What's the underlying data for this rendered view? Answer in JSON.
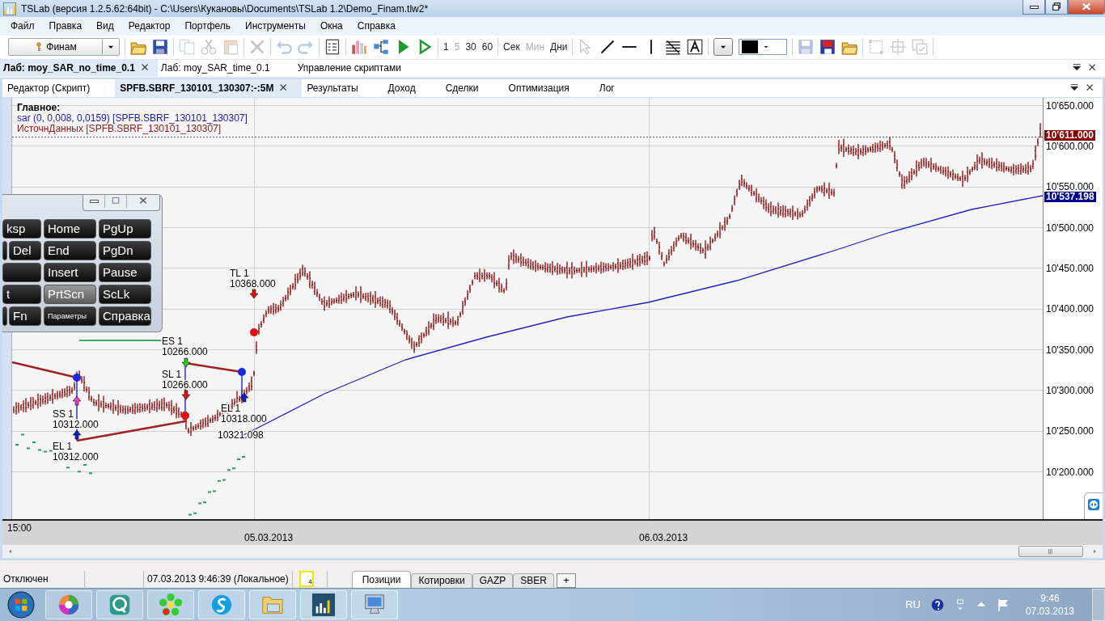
{
  "window": {
    "title": "TSLab (версия 1.2.5.62:64bit) - C:\\Users\\Кукановы\\Documents\\TSLab 1.2\\Demo_Finam.tlw2*"
  },
  "menu": [
    "Файл",
    "Правка",
    "Вид",
    "Редактор",
    "Портфель",
    "Инструменты",
    "Окна",
    "Справка"
  ],
  "toolbar": [
    [
      {
        "kind": "combo",
        "label": "Финам"
      }
    ],
    [
      {
        "kind": "open",
        "disabled": false
      },
      {
        "kind": "save",
        "disabled": false
      }
    ],
    [
      {
        "kind": "copy",
        "disabled": true
      },
      {
        "kind": "cut",
        "disabled": true
      },
      {
        "kind": "paste",
        "disabled": true
      }
    ],
    [
      {
        "kind": "delete",
        "disabled": true
      }
    ],
    [
      {
        "kind": "undo",
        "disabled": true
      },
      {
        "kind": "redo",
        "disabled": true
      }
    ],
    [
      {
        "kind": "properties",
        "disabled": false
      }
    ],
    [
      {
        "kind": "bars",
        "disabled": false
      },
      {
        "kind": "tree",
        "disabled": false
      },
      {
        "kind": "play",
        "disabled": false
      },
      {
        "kind": "play-outline",
        "disabled": false
      }
    ],
    [
      {
        "kind": "text",
        "label": "1",
        "disabled": false
      },
      {
        "kind": "text",
        "label": "5",
        "disabled": true
      },
      {
        "kind": "text",
        "label": "30",
        "disabled": false
      },
      {
        "kind": "text",
        "label": "60",
        "disabled": false
      }
    ],
    [
      {
        "kind": "text",
        "label": "Сек",
        "disabled": false
      },
      {
        "kind": "text",
        "label": "Мин",
        "disabled": true
      },
      {
        "kind": "text",
        "label": "Дни",
        "disabled": false
      }
    ],
    [
      {
        "kind": "cursor",
        "disabled": true
      },
      {
        "kind": "line",
        "disabled": false
      },
      {
        "kind": "hline",
        "disabled": false
      },
      {
        "kind": "vline",
        "disabled": false
      },
      {
        "kind": "hatch",
        "disabled": false
      },
      {
        "kind": "textbox",
        "disabled": false
      }
    ],
    [
      {
        "kind": "dropdown"
      },
      {
        "kind": "swatch"
      }
    ],
    [
      {
        "kind": "save",
        "disabled": true
      },
      {
        "kind": "saveas",
        "disabled": false
      },
      {
        "kind": "open",
        "disabled": false
      }
    ],
    [
      {
        "kind": "frame",
        "disabled": true
      },
      {
        "kind": "frame2",
        "disabled": true
      },
      {
        "kind": "pages",
        "disabled": true
      }
    ]
  ],
  "doc_tabs": [
    {
      "label": "Лаб: moy_SAR_no_time_0.1",
      "selected": true
    },
    {
      "label": "Лаб: moy_SAR_time_0.1",
      "selected": false
    },
    {
      "label": "Управление скриптами",
      "selected": false
    }
  ],
  "inner_tabs": [
    {
      "label": "Редактор (Скрипт)",
      "selected": false
    },
    {
      "label": "SPFB.SBRF_130101_130307:-:5M",
      "selected": true
    },
    {
      "label": "Результаты",
      "selected": false
    },
    {
      "label": "Доход",
      "selected": false
    },
    {
      "label": "Сделки",
      "selected": false
    },
    {
      "label": "Оптимизация",
      "selected": false
    },
    {
      "label": "Лог",
      "selected": false
    }
  ],
  "chart": {
    "legend_title": "Главное:",
    "legend": [
      {
        "text": "sar (0, 0,008, 0,0159) [SPFB.SBRF_130101_130307]",
        "color": "#1a1aa0"
      },
      {
        "text": "ИсточнДанных [SPFB.SBRF_130101_130307]",
        "color": "#8b1a1a"
      }
    ],
    "y_axis_labels": [
      "10'650.000",
      "10'600.000",
      "10'550.000",
      "10'500.000",
      "10'450.000",
      "10'400.000",
      "10'350.000",
      "10'300.000",
      "10'250.000",
      "10'200.000"
    ],
    "price_labels": [
      {
        "text": "10'611.000",
        "color": "#8b0000"
      },
      {
        "text": "10'537.198",
        "color": "#00008b"
      }
    ],
    "trade_labels": [
      {
        "signal": "TL 1",
        "price": "10368.000"
      },
      {
        "signal": "ES 1",
        "price": "10266.000"
      },
      {
        "signal": "SL 1",
        "price": "10266.000"
      },
      {
        "signal": "SS 1",
        "price": "10312.000"
      },
      {
        "signal": "EL 1",
        "price": "10312.000"
      },
      {
        "signal": "EL 1",
        "price": "10318.000"
      },
      {
        "price": "10321.098"
      }
    ],
    "time_labels": [
      "15:00",
      "05.03.2013",
      "06.03.2013"
    ]
  },
  "keyboard": [
    {
      "label": "ksp",
      "active": false
    },
    {
      "label": "Home",
      "active": false
    },
    {
      "label": "PgUp",
      "active": false
    },
    {
      "active": false
    },
    {
      "label": "Del",
      "active": false
    },
    {
      "label": "End",
      "active": false
    },
    {
      "label": "PgDn",
      "active": false
    },
    {
      "active": false
    },
    {
      "label": "Insert",
      "active": false
    },
    {
      "label": "Pause",
      "active": false
    },
    {
      "label": "t",
      "active": false
    },
    {
      "label": "PrtScn",
      "active": true
    },
    {
      "label": "ScLk",
      "active": false
    },
    {
      "active": false
    },
    {
      "label": "Fn",
      "active": false
    },
    {
      "label": "Параметры",
      "active": false
    },
    {
      "label": "Справка",
      "active": false
    }
  ],
  "status_bar": {
    "connection": "Отключен",
    "time": "07.03.2013 9:46:39 (Локальное)",
    "notes_count": "4",
    "tabs": [
      {
        "label": "Позиции",
        "selected": true
      },
      {
        "label": "Котировки",
        "selected": false
      },
      {
        "label": "GAZP",
        "selected": false
      },
      {
        "label": "SBER",
        "selected": false
      }
    ],
    "add": "+"
  },
  "taskbar": {
    "apps": [
      {
        "kind": "wheel"
      },
      {
        "kind": "bubble"
      },
      {
        "kind": "flower"
      },
      {
        "kind": "phone"
      },
      {
        "kind": "folder"
      },
      {
        "kind": "chart"
      },
      {
        "kind": "keyboard"
      }
    ],
    "language": "RU",
    "time": "9:46",
    "date": "07.03.2013"
  }
}
